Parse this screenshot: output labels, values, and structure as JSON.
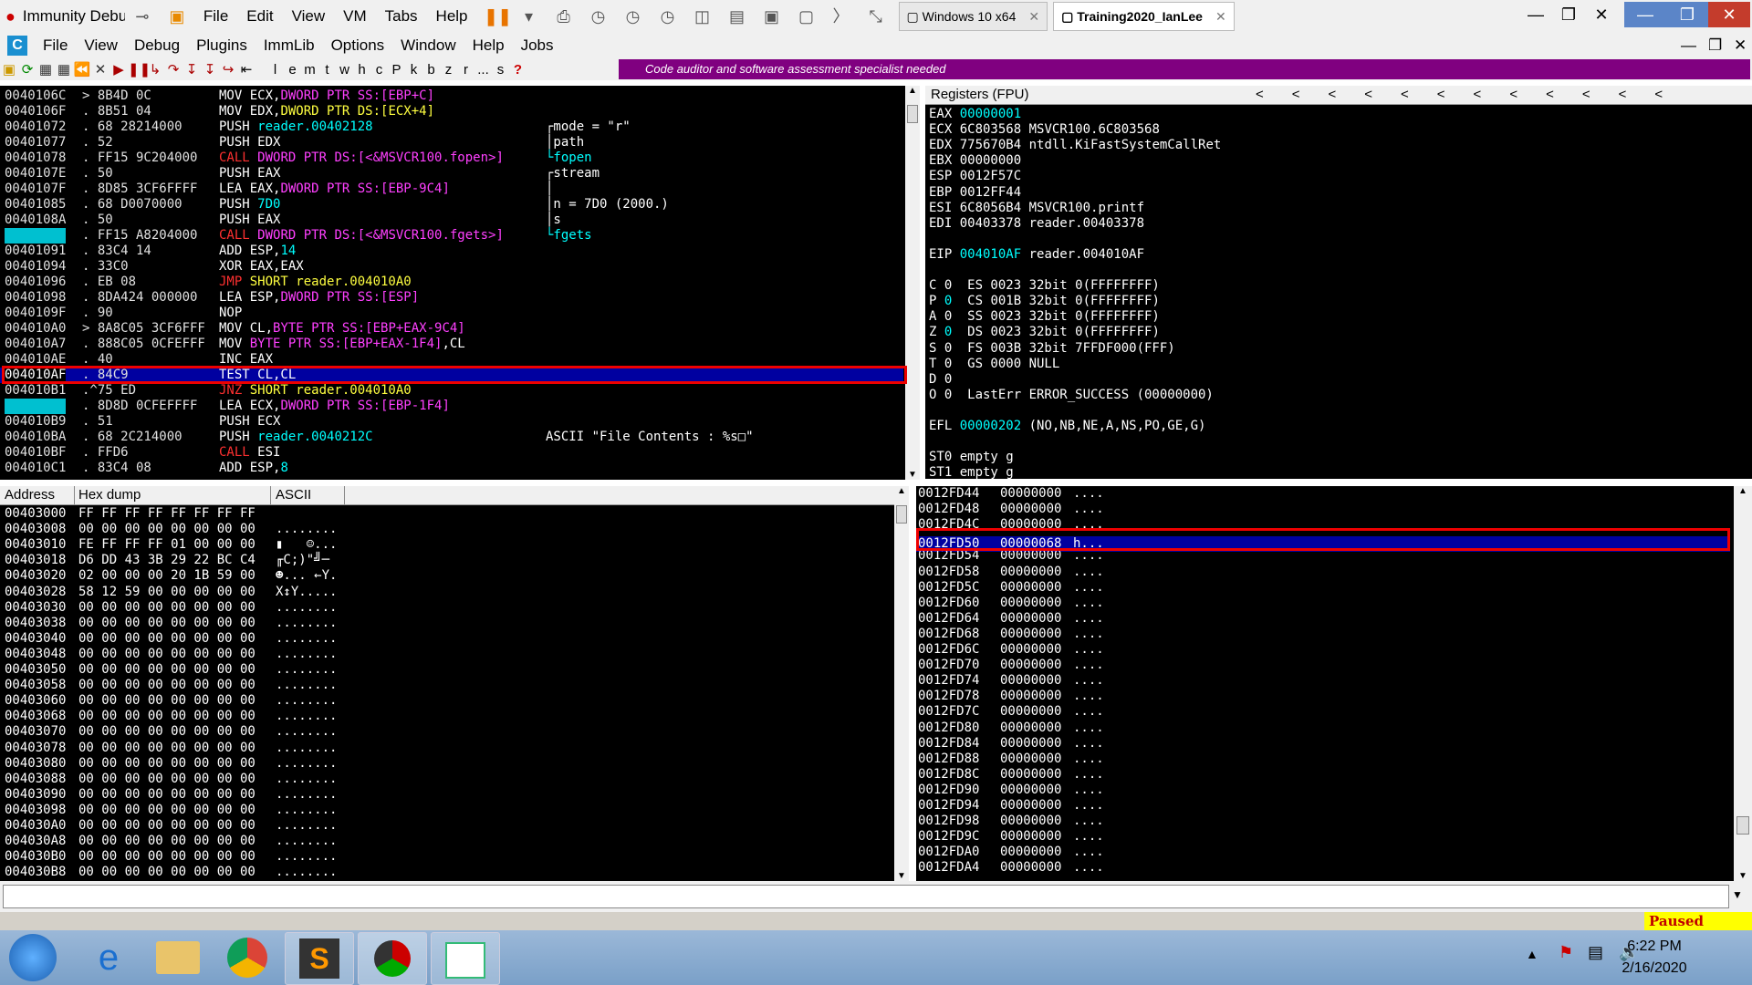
{
  "vmware": {
    "app_title": "Immunity Debu",
    "menu": [
      "File",
      "Edit",
      "View",
      "VM",
      "Tabs",
      "Help"
    ],
    "tabs": [
      {
        "label": "Windows 10 x64",
        "active": false
      },
      {
        "label": "Training2020_IanLee",
        "active": true
      }
    ]
  },
  "immunity": {
    "menu": [
      "File",
      "View",
      "Debug",
      "Plugins",
      "ImmLib",
      "Options",
      "Window",
      "Help",
      "Jobs"
    ],
    "tool_letters": [
      "l",
      "e",
      "m",
      "t",
      "w",
      "h",
      "c",
      "P",
      "k",
      "b",
      "z",
      "r",
      "...",
      "s",
      "?"
    ],
    "status_message": "Code auditor and software assessment specialist needed"
  },
  "disasm": [
    {
      "addr": "0040106C",
      "hex": "> 8B4D 0C",
      "parts": [
        [
          "w",
          "MOV "
        ],
        [
          "w",
          "ECX,"
        ],
        [
          "m",
          "DWORD PTR SS:[EBP+C]"
        ]
      ],
      "comment": ""
    },
    {
      "addr": "0040106F",
      "hex": ". 8B51 04",
      "parts": [
        [
          "w",
          "MOV EDX,"
        ],
        [
          "y",
          "DWORD PTR DS:[ECX+4]"
        ]
      ],
      "comment": ""
    },
    {
      "addr": "00401072",
      "hex": ". 68 28214000",
      "parts": [
        [
          "w",
          "PUSH "
        ],
        [
          "c",
          "reader.00402128"
        ]
      ],
      "comment": "┌mode = \"r\""
    },
    {
      "addr": "00401077",
      "hex": ". 52",
      "parts": [
        [
          "w",
          "PUSH EDX"
        ]
      ],
      "comment": "│path"
    },
    {
      "addr": "00401078",
      "hex": ". FF15 9C204000",
      "parts": [
        [
          "r",
          "CALL "
        ],
        [
          "m",
          "DWORD PTR DS:[<&MSVCR100.fopen>]"
        ]
      ],
      "comment": "└fopen"
    },
    {
      "addr": "0040107E",
      "hex": ". 50",
      "parts": [
        [
          "w",
          "PUSH EAX"
        ]
      ],
      "comment": "┌stream"
    },
    {
      "addr": "0040107F",
      "hex": ". 8D85 3CF6FFFF",
      "parts": [
        [
          "w",
          "LEA EAX,"
        ],
        [
          "m",
          "DWORD PTR SS:[EBP-9C4]"
        ]
      ],
      "comment": "│"
    },
    {
      "addr": "00401085",
      "hex": ". 68 D0070000",
      "parts": [
        [
          "w",
          "PUSH "
        ],
        [
          "c",
          "7D0"
        ]
      ],
      "comment": "│n = 7D0 (2000.)"
    },
    {
      "addr": "0040108A",
      "hex": ". 50",
      "parts": [
        [
          "w",
          "PUSH EAX"
        ]
      ],
      "comment": "│s"
    },
    {
      "addr": "0040108B",
      "hex": ". FF15 A8204000",
      "parts": [
        [
          "r",
          "CALL "
        ],
        [
          "m",
          "DWORD PTR DS:[<&MSVCR100.fgets>]"
        ]
      ],
      "comment": "└fgets",
      "addrhl": true
    },
    {
      "addr": "00401091",
      "hex": ". 83C4 14",
      "parts": [
        [
          "w",
          "ADD ESP,"
        ],
        [
          "c",
          "14"
        ]
      ],
      "comment": ""
    },
    {
      "addr": "00401094",
      "hex": ". 33C0",
      "parts": [
        [
          "w",
          "XOR EAX,EAX"
        ]
      ],
      "comment": ""
    },
    {
      "addr": "00401096",
      "hex": ". EB 08",
      "parts": [
        [
          "r",
          "JMP "
        ],
        [
          "y",
          "SHORT reader.004010A0"
        ]
      ],
      "comment": ""
    },
    {
      "addr": "00401098",
      "hex": ". 8DA424 000000",
      "parts": [
        [
          "w",
          "LEA ESP,"
        ],
        [
          "m",
          "DWORD PTR SS:[ESP]"
        ]
      ],
      "comment": ""
    },
    {
      "addr": "0040109F",
      "hex": ". 90",
      "parts": [
        [
          "w",
          "NOP"
        ]
      ],
      "comment": ""
    },
    {
      "addr": "004010A0",
      "hex": "> 8A8C05 3CF6FFF",
      "parts": [
        [
          "w",
          "MOV CL,"
        ],
        [
          "m",
          "BYTE PTR SS:[EBP+EAX-9C4]"
        ]
      ],
      "comment": ""
    },
    {
      "addr": "004010A7",
      "hex": ". 888C05 0CFEFFF",
      "parts": [
        [
          "w",
          "MOV "
        ],
        [
          "m",
          "BYTE PTR SS:[EBP+EAX-1F4]"
        ],
        [
          "w",
          ",CL"
        ]
      ],
      "comment": ""
    },
    {
      "addr": "004010AE",
      "hex": ". 40",
      "parts": [
        [
          "w",
          "INC EAX"
        ]
      ],
      "comment": ""
    },
    {
      "addr": "004010AF",
      "hex": ". 84C9",
      "parts": [
        [
          "w",
          "TEST CL,CL"
        ]
      ],
      "comment": "",
      "selected": true
    },
    {
      "addr": "004010B1",
      "hex": ".^75 ED",
      "parts": [
        [
          "r",
          "JNZ "
        ],
        [
          "y",
          "SHORT reader.004010A0"
        ]
      ],
      "comment": ""
    },
    {
      "addr": "004010B3",
      "hex": ". 8D8D 0CFEFFFF",
      "parts": [
        [
          "w",
          "LEA ECX,"
        ],
        [
          "m",
          "DWORD PTR SS:[EBP-1F4]"
        ]
      ],
      "comment": "",
      "addrhl": true
    },
    {
      "addr": "004010B9",
      "hex": ". 51",
      "parts": [
        [
          "w",
          "PUSH ECX"
        ]
      ],
      "comment": ""
    },
    {
      "addr": "004010BA",
      "hex": ". 68 2C214000",
      "parts": [
        [
          "w",
          "PUSH "
        ],
        [
          "c",
          "reader.0040212C"
        ]
      ],
      "comment": "ASCII \"File Contents : %s□\""
    },
    {
      "addr": "004010BF",
      "hex": ". FFD6",
      "parts": [
        [
          "r",
          "CALL "
        ],
        [
          "w",
          "ESI"
        ]
      ],
      "comment": ""
    },
    {
      "addr": "004010C1",
      "hex": ". 83C4 08",
      "parts": [
        [
          "w",
          "ADD ESP,"
        ],
        [
          "c",
          "8"
        ]
      ],
      "comment": ""
    }
  ],
  "registers": {
    "title": "Registers (FPU)",
    "rows": [
      {
        "t": "EAX ",
        "v": "00000001",
        "x": "",
        "hl": true
      },
      {
        "t": "ECX ",
        "v": "6C803568",
        "x": " MSVCR100.6C803568"
      },
      {
        "t": "EDX ",
        "v": "775670B4",
        "x": " ntdll.KiFastSystemCallRet"
      },
      {
        "t": "EBX ",
        "v": "00000000",
        "x": ""
      },
      {
        "t": "ESP ",
        "v": "0012F57C",
        "x": ""
      },
      {
        "t": "EBP ",
        "v": "0012FF44",
        "x": ""
      },
      {
        "t": "ESI ",
        "v": "6C8056B4",
        "x": " MSVCR100.printf"
      },
      {
        "t": "EDI ",
        "v": "00403378",
        "x": " reader.00403378"
      },
      {
        "t": "",
        "v": "",
        "x": ""
      },
      {
        "t": "EIP ",
        "v": "004010AF",
        "x": " reader.004010AF",
        "hl": true
      },
      {
        "t": "",
        "v": "",
        "x": ""
      },
      {
        "t": "C 0  ES 0023 32bit 0(FFFFFFFF)",
        "v": "",
        "x": ""
      },
      {
        "t": "P ",
        "v": "0",
        "x": "  CS 001B 32bit 0(FFFFFFFF)",
        "hl": true
      },
      {
        "t": "A 0  SS 0023 32bit 0(FFFFFFFF)",
        "v": "",
        "x": ""
      },
      {
        "t": "Z ",
        "v": "0",
        "x": "  DS 0023 32bit 0(FFFFFFFF)",
        "hl": true
      },
      {
        "t": "S 0  FS 003B 32bit 7FFDF000(FFF)",
        "v": "",
        "x": ""
      },
      {
        "t": "T 0  GS 0000 NULL",
        "v": "",
        "x": ""
      },
      {
        "t": "D 0",
        "v": "",
        "x": ""
      },
      {
        "t": "O 0  LastErr ERROR_SUCCESS (00000000)",
        "v": "",
        "x": ""
      },
      {
        "t": "",
        "v": "",
        "x": ""
      },
      {
        "t": "EFL ",
        "v": "00000202",
        "x": " (NO,NB,NE,A,NS,PO,GE,G)",
        "hl": true
      },
      {
        "t": "",
        "v": "",
        "x": ""
      },
      {
        "t": "ST0 empty g",
        "v": "",
        "x": ""
      },
      {
        "t": "ST1 empty g",
        "v": "",
        "x": ""
      },
      {
        "t": "ST2 empty g",
        "v": "",
        "x": ""
      },
      {
        "t": "ST3 empty g",
        "v": "",
        "x": ""
      }
    ]
  },
  "dump": {
    "headers": [
      "Address",
      "Hex dump",
      "ASCII"
    ],
    "rows": [
      [
        "00403000",
        "FF FF FF FF FF FF FF FF",
        ""
      ],
      [
        "00403008",
        "00 00 00 00 00 00 00 00",
        "........"
      ],
      [
        "00403010",
        "FE FF FF FF 01 00 00 00",
        "▮   ☺..."
      ],
      [
        "00403018",
        "D6 DD 43 3B 29 22 BC C4",
        "╓C;)\"╝─"
      ],
      [
        "00403020",
        "02 00 00 00 20 1B 59 00",
        "☻... ←Y."
      ],
      [
        "00403028",
        "58 12 59 00 00 00 00 00",
        "X↕Y....."
      ],
      [
        "00403030",
        "00 00 00 00 00 00 00 00",
        "........"
      ],
      [
        "00403038",
        "00 00 00 00 00 00 00 00",
        "........"
      ],
      [
        "00403040",
        "00 00 00 00 00 00 00 00",
        "........"
      ],
      [
        "00403048",
        "00 00 00 00 00 00 00 00",
        "........"
      ],
      [
        "00403050",
        "00 00 00 00 00 00 00 00",
        "........"
      ],
      [
        "00403058",
        "00 00 00 00 00 00 00 00",
        "........"
      ],
      [
        "00403060",
        "00 00 00 00 00 00 00 00",
        "........"
      ],
      [
        "00403068",
        "00 00 00 00 00 00 00 00",
        "........"
      ],
      [
        "00403070",
        "00 00 00 00 00 00 00 00",
        "........"
      ],
      [
        "00403078",
        "00 00 00 00 00 00 00 00",
        "........"
      ],
      [
        "00403080",
        "00 00 00 00 00 00 00 00",
        "........"
      ],
      [
        "00403088",
        "00 00 00 00 00 00 00 00",
        "........"
      ],
      [
        "00403090",
        "00 00 00 00 00 00 00 00",
        "........"
      ],
      [
        "00403098",
        "00 00 00 00 00 00 00 00",
        "........"
      ],
      [
        "004030A0",
        "00 00 00 00 00 00 00 00",
        "........"
      ],
      [
        "004030A8",
        "00 00 00 00 00 00 00 00",
        "........"
      ],
      [
        "004030B0",
        "00 00 00 00 00 00 00 00",
        "........"
      ],
      [
        "004030B8",
        "00 00 00 00 00 00 00 00",
        "........"
      ]
    ]
  },
  "stack": [
    [
      "0012FD44",
      "00000000",
      "...."
    ],
    [
      "0012FD48",
      "00000000",
      "...."
    ],
    [
      "0012FD4C",
      "00000000",
      "...."
    ],
    [
      "0012FD50",
      "00000068",
      "h...",
      "sel"
    ],
    [
      "0012FD54",
      "00000000",
      "...."
    ],
    [
      "0012FD58",
      "00000000",
      "...."
    ],
    [
      "0012FD5C",
      "00000000",
      "...."
    ],
    [
      "0012FD60",
      "00000000",
      "...."
    ],
    [
      "0012FD64",
      "00000000",
      "...."
    ],
    [
      "0012FD68",
      "00000000",
      "...."
    ],
    [
      "0012FD6C",
      "00000000",
      "...."
    ],
    [
      "0012FD70",
      "00000000",
      "...."
    ],
    [
      "0012FD74",
      "00000000",
      "...."
    ],
    [
      "0012FD78",
      "00000000",
      "...."
    ],
    [
      "0012FD7C",
      "00000000",
      "...."
    ],
    [
      "0012FD80",
      "00000000",
      "...."
    ],
    [
      "0012FD84",
      "00000000",
      "...."
    ],
    [
      "0012FD88",
      "00000000",
      "...."
    ],
    [
      "0012FD8C",
      "00000000",
      "...."
    ],
    [
      "0012FD90",
      "00000000",
      "...."
    ],
    [
      "0012FD94",
      "00000000",
      "...."
    ],
    [
      "0012FD98",
      "00000000",
      "...."
    ],
    [
      "0012FD9C",
      "00000000",
      "...."
    ],
    [
      "0012FDA0",
      "00000000",
      "...."
    ],
    [
      "0012FDA4",
      "00000000",
      "...."
    ]
  ],
  "status": {
    "state": "Paused"
  },
  "clock": {
    "time": "6:22 PM",
    "date": "2/16/2020"
  }
}
